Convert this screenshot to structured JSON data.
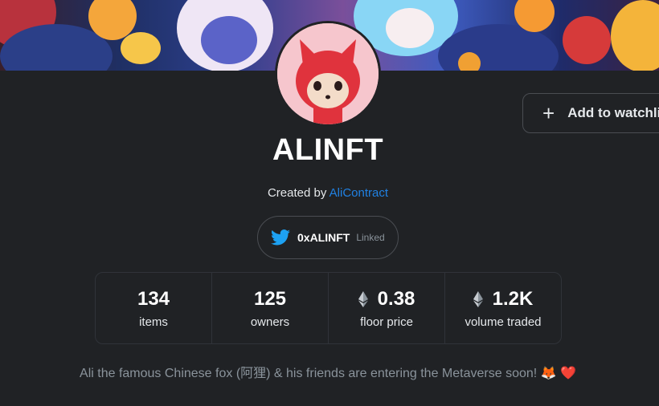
{
  "collection": {
    "name": "ALINFT",
    "created_by_prefix": "Created by ",
    "creator": "AliContract",
    "description": "Ali the famous Chinese fox (阿狸) & his friends are entering the Metaverse soon! 🦊 ❤️"
  },
  "watchlist": {
    "label": "Add to watchlist",
    "icon": "plus-icon"
  },
  "twitter": {
    "handle": "0xALINFT",
    "status": "Linked",
    "icon": "twitter-icon"
  },
  "stats": [
    {
      "value": "134",
      "label": "items",
      "eth": false
    },
    {
      "value": "125",
      "label": "owners",
      "eth": false
    },
    {
      "value": "0.38",
      "label": "floor price",
      "eth": true
    },
    {
      "value": "1.2K",
      "label": "volume traded",
      "eth": true
    }
  ],
  "colors": {
    "background": "#202225",
    "link": "#2081e2",
    "twitter": "#1da1f2",
    "avatar_bg": "#f6c6cd",
    "fox_red": "#e0333d"
  }
}
